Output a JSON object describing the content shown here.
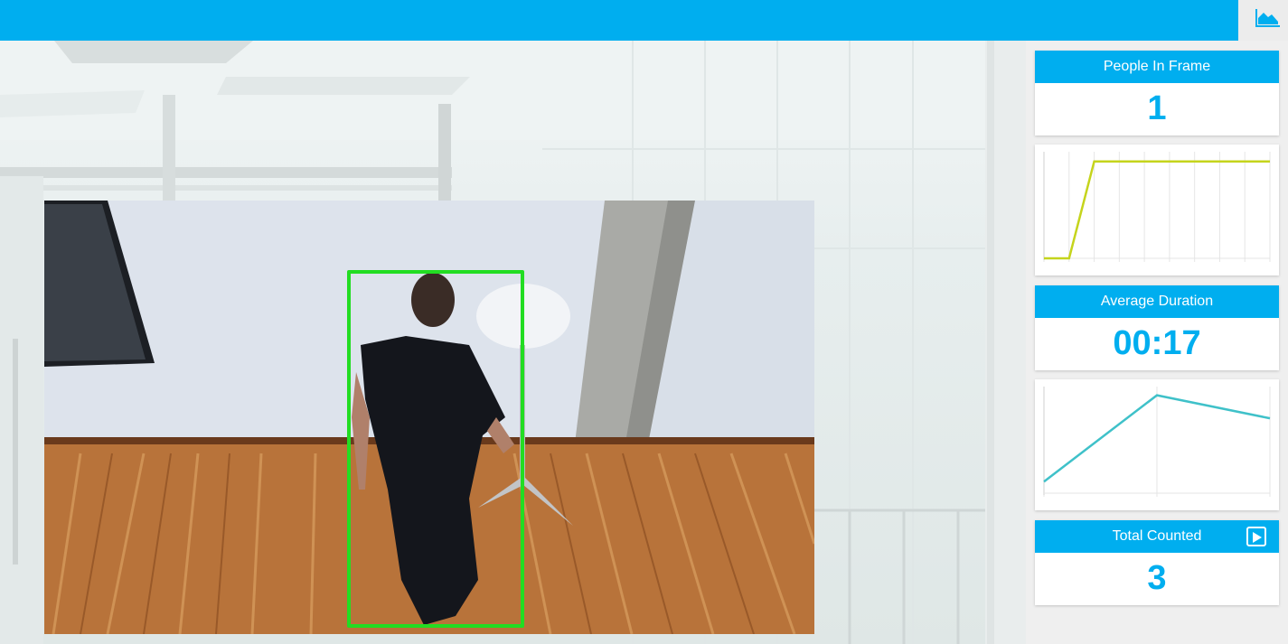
{
  "header": {
    "chart_toggle_icon": "area-chart-icon",
    "accent_color": "#00aeef"
  },
  "video": {
    "detection_box_color": "#22dd22"
  },
  "stats": {
    "people_in_frame": {
      "label": "People In Frame",
      "value": "1"
    },
    "average_duration": {
      "label": "Average Duration",
      "value": "00:17"
    },
    "total_counted": {
      "label": "Total Counted",
      "value": "3",
      "action_icon": "play-icon"
    }
  },
  "chart_data": [
    {
      "type": "line",
      "series": [
        {
          "values": [
            0,
            0,
            1,
            1,
            1,
            1,
            1,
            1,
            1,
            1
          ],
          "color": "#c5d41c"
        }
      ],
      "x": [
        0,
        1,
        2,
        3,
        4,
        5,
        6,
        7,
        8,
        9
      ],
      "ylim": [
        0,
        1.1
      ],
      "grid": true
    },
    {
      "type": "line",
      "series": [
        {
          "values": [
            2,
            17,
            13
          ],
          "color": "#3fc1c9"
        }
      ],
      "x": [
        0,
        1,
        2
      ],
      "ylim": [
        0,
        18.5
      ],
      "grid": true
    }
  ]
}
